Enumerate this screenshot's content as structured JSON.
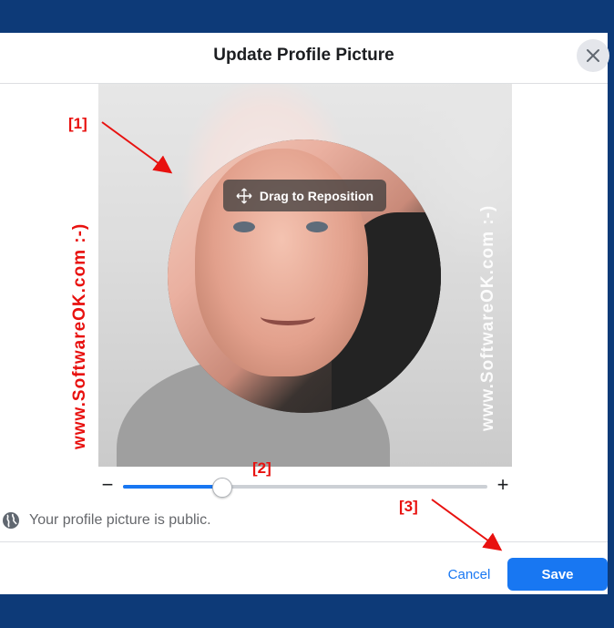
{
  "dialog": {
    "title": "Update Profile Picture",
    "drag_hint": "Drag to Reposition",
    "public_notice": "Your profile picture is public.",
    "cancel_label": "Cancel",
    "save_label": "Save",
    "zoom": {
      "minus": "−",
      "plus": "+",
      "level": 0.27
    }
  },
  "annotations": {
    "label_1": "[1]",
    "label_2": "[2]",
    "label_3": "[3]",
    "watermark_left": "www.SoftwareOK.com :-)",
    "watermark_right": "www.SoftwareOK.com :-)"
  },
  "colors": {
    "accent": "#1877f2",
    "frame": "#0d3a78",
    "annotation": "#e8110f"
  },
  "icons": [
    "close-icon",
    "move-arrows-icon",
    "globe-icon"
  ]
}
